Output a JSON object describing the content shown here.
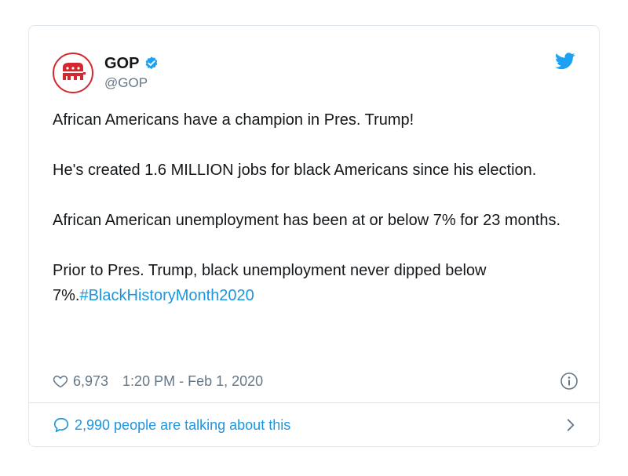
{
  "account": {
    "name": "GOP",
    "handle": "@GOP",
    "verified": true,
    "avatar_icon": "gop-elephant-icon"
  },
  "tweet": {
    "paragraphs": [
      "African Americans have a champion in Pres. Trump!",
      "He's created 1.6 MILLION jobs for black Americans since his election.",
      "African American unemployment has been at or below 7% for 23 months."
    ],
    "last_paragraph_text": "Prior to Pres. Trump, black unemployment never dipped below 7%.",
    "hashtag": "#BlackHistoryMonth2020"
  },
  "meta": {
    "likes": "6,973",
    "timestamp": "1:20 PM - Feb 1, 2020"
  },
  "footer": {
    "talking_text": "2,990 people are talking about this"
  },
  "colors": {
    "accent": "#1b95e0",
    "brand_red": "#d2282f",
    "text": "#14171a",
    "muted": "#657786",
    "border": "#e1e8ed"
  },
  "icons": {
    "twitter": "twitter-bird-icon",
    "verified": "verified-badge-icon",
    "like": "heart-icon",
    "info": "info-icon",
    "reply": "speech-bubble-icon",
    "more": "chevron-right-icon"
  }
}
